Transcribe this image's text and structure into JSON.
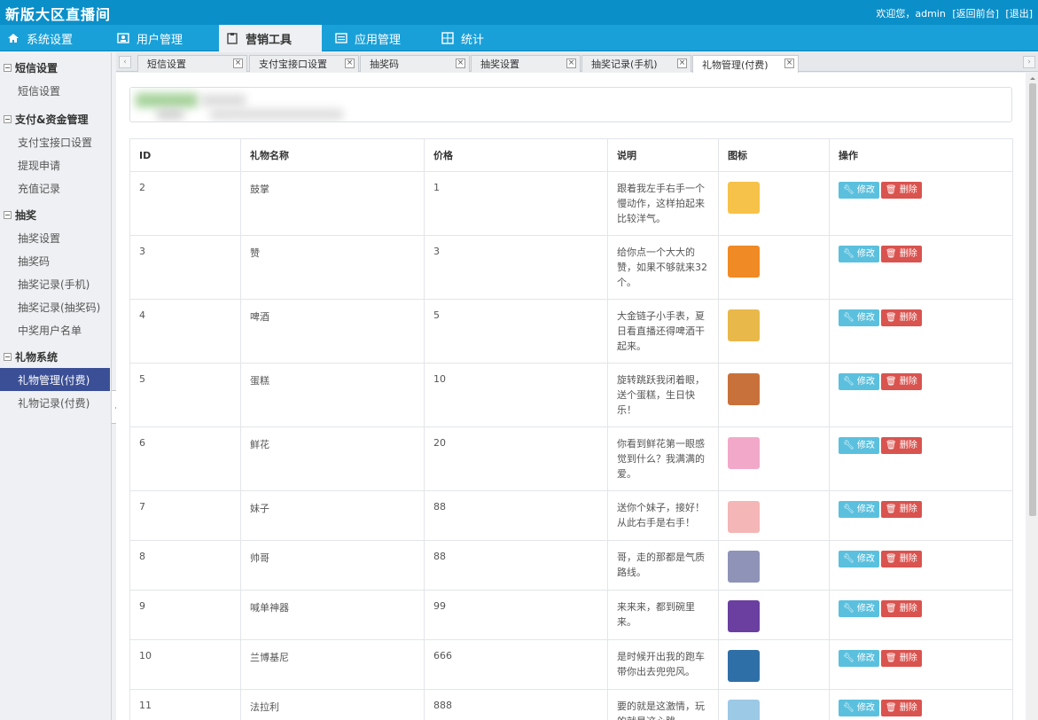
{
  "header": {
    "app_title": "新版大区直播间",
    "welcome": "欢迎您，admin",
    "front_link": "[返回前台]",
    "logout_link": "[退出]"
  },
  "main_nav": [
    {
      "label": "系统设置",
      "icon": "home-icon"
    },
    {
      "label": "用户管理",
      "icon": "user-card-icon"
    },
    {
      "label": "营销工具",
      "icon": "clipboard-icon",
      "active": true
    },
    {
      "label": "应用管理",
      "icon": "list-window-icon"
    },
    {
      "label": "统计",
      "icon": "grid-chart-icon"
    }
  ],
  "sidebar": {
    "groups": [
      {
        "title": "短信设置",
        "items": [
          "短信设置"
        ]
      },
      {
        "title": "支付&资金管理",
        "items": [
          "支付宝接口设置",
          "提现申请",
          "充值记录"
        ]
      },
      {
        "title": "抽奖",
        "items": [
          "抽奖设置",
          "抽奖码",
          "抽奖记录(手机)",
          "抽奖记录(抽奖码)",
          "中奖用户名单"
        ]
      },
      {
        "title": "礼物系统",
        "items": [
          "礼物管理(付费)",
          "礼物记录(付费)"
        ]
      }
    ],
    "active_item": "礼物管理(付费)"
  },
  "tabs": [
    {
      "label": "短信设置"
    },
    {
      "label": "支付宝接口设置"
    },
    {
      "label": "抽奖码"
    },
    {
      "label": "抽奖设置"
    },
    {
      "label": "抽奖记录(手机)"
    },
    {
      "label": "礼物管理(付费)",
      "active": true
    }
  ],
  "tab_close_glyph": "×",
  "table": {
    "headers": [
      "ID",
      "礼物名称",
      "价格",
      "说明",
      "图标",
      "操作"
    ],
    "edit_label": "修改",
    "delete_label": "删除",
    "rows": [
      {
        "id": "2",
        "name": "鼓掌",
        "price": "1",
        "desc": "跟着我左手右手一个慢动作，这样拍起来比较洋气。",
        "icon_color": "#f7c24a"
      },
      {
        "id": "3",
        "name": "赞",
        "price": "3",
        "desc": "给你点一个大大的赞，如果不够就来32个。",
        "icon_color": "#f08a24"
      },
      {
        "id": "4",
        "name": "啤酒",
        "price": "5",
        "desc": "大金链子小手表，夏日看直播还得啤酒干起来。",
        "icon_color": "#e8b84a"
      },
      {
        "id": "5",
        "name": "蛋糕",
        "price": "10",
        "desc": "旋转跳跃我闭着眼，送个蛋糕，生日快乐！",
        "icon_color": "#c9713a"
      },
      {
        "id": "6",
        "name": "鲜花",
        "price": "20",
        "desc": "你看到鲜花第一眼感觉到什么？我满满的爱。",
        "icon_color": "#f2a9c9"
      },
      {
        "id": "7",
        "name": "妹子",
        "price": "88",
        "desc": "送你个妹子，接好！从此右手是右手！",
        "icon_color": "#f4b6b6"
      },
      {
        "id": "8",
        "name": "帅哥",
        "price": "88",
        "desc": "哥，走的那都是气质路线。",
        "icon_color": "#8f93b8"
      },
      {
        "id": "9",
        "name": "喊单神器",
        "price": "99",
        "desc": "来来来，都到碗里来。",
        "icon_color": "#6a3fa0"
      },
      {
        "id": "10",
        "name": "兰博基尼",
        "price": "666",
        "desc": "是时候开出我的跑车带你出去兜兜风。",
        "icon_color": "#2f6fa7"
      },
      {
        "id": "11",
        "name": "法拉利",
        "price": "888",
        "desc": "要的就是这激情，玩的就是这心跳。",
        "icon_color": "#9cc9e6"
      }
    ]
  },
  "colors": {
    "header_bg": "#0b8fc9",
    "nav_bg": "#1aa0d8",
    "sidebar_active": "#3b4f96",
    "edit_button": "#5bc0de",
    "delete_button": "#d9534f"
  }
}
